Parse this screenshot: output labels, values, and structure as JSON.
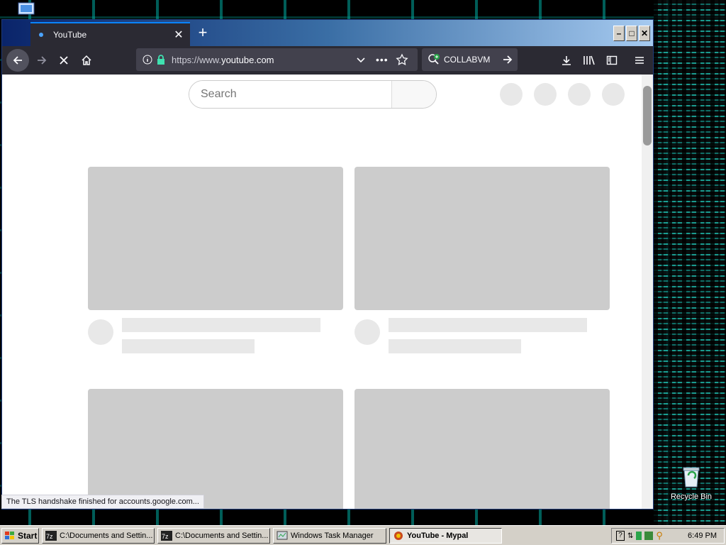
{
  "browser": {
    "tab_title": "YouTube",
    "url_prefix": "https://www.",
    "url_domain": "youtube.com",
    "search_engine_label": "COLLABVM",
    "status_text": "The TLS handshake finished for accounts.google.com..."
  },
  "page": {
    "search_placeholder": "Search"
  },
  "desktop": {
    "recycle_bin_label": "Recycle Bin"
  },
  "taskbar": {
    "start_label": "Start",
    "tasks": [
      {
        "label": "C:\\Documents and Settin..."
      },
      {
        "label": "C:\\Documents and Settin..."
      },
      {
        "label": "Windows Task Manager"
      },
      {
        "label": "YouTube - Mypal"
      }
    ],
    "clock": "6:49 PM"
  }
}
